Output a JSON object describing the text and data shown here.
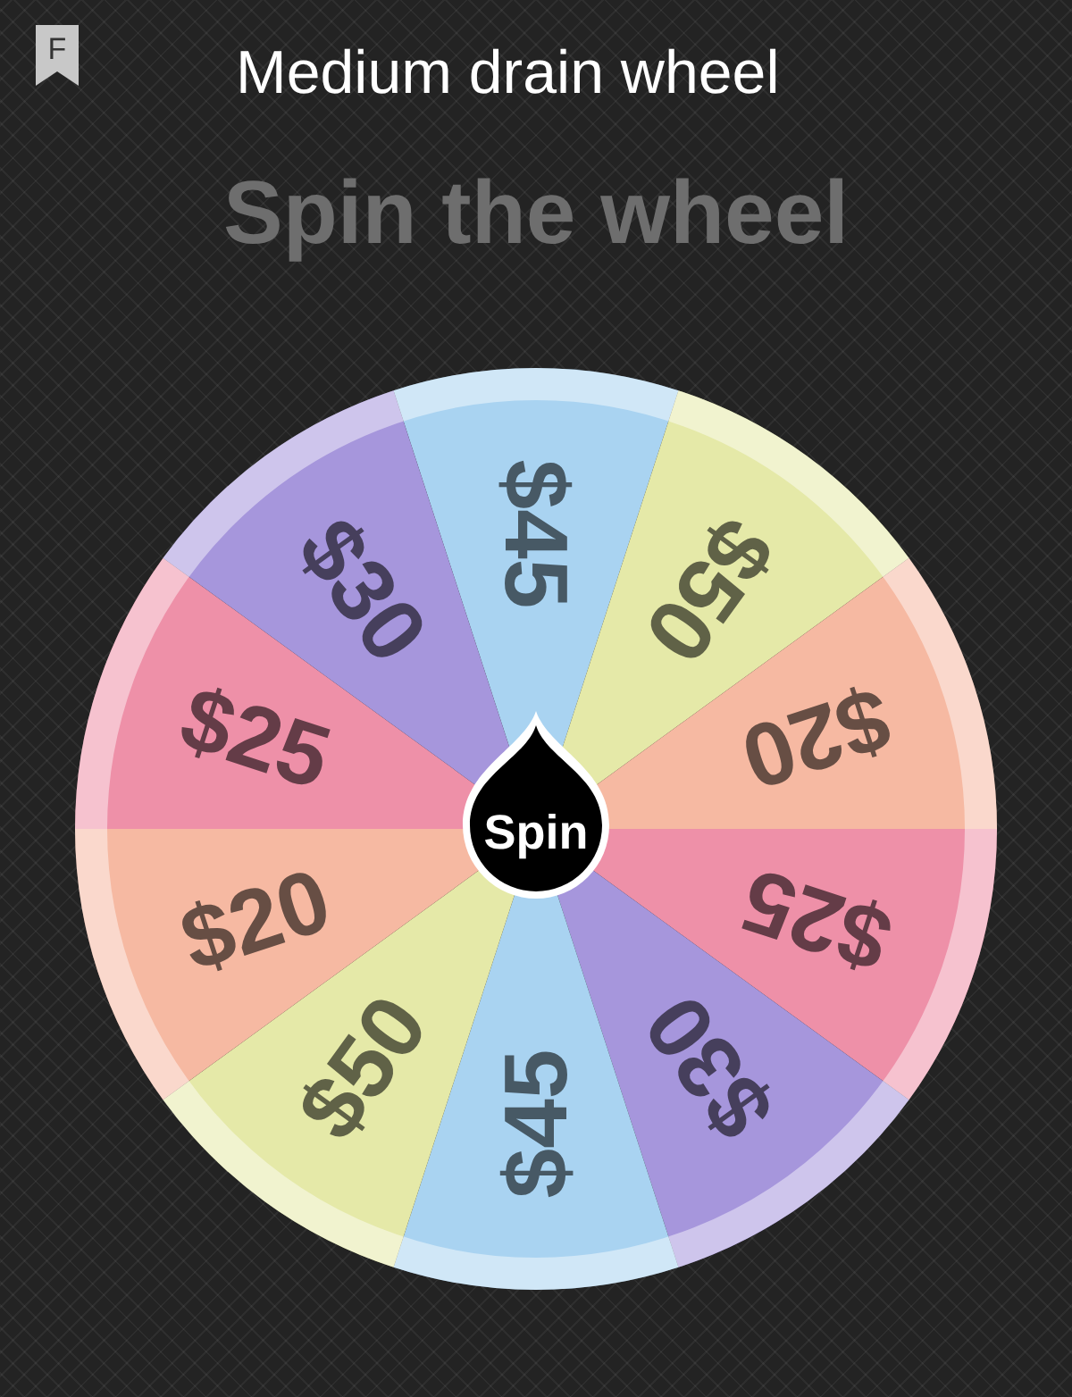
{
  "app_badge": {
    "letter": "F"
  },
  "title": "Medium drain wheel",
  "heading": "Spin the wheel",
  "wheel": {
    "segments": [
      {
        "label": "$45",
        "color": "#a9d3f1"
      },
      {
        "label": "$50",
        "color": "#e5e9a8"
      },
      {
        "label": "$20",
        "color": "#f6b9a2"
      },
      {
        "label": "$25",
        "color": "#ee90a8"
      },
      {
        "label": "$30",
        "color": "#a696dc"
      },
      {
        "label": "$45",
        "color": "#a9d3f1"
      },
      {
        "label": "$50",
        "color": "#e5e9a8"
      },
      {
        "label": "$20",
        "color": "#f6b9a2"
      },
      {
        "label": "$25",
        "color": "#ee90a8"
      },
      {
        "label": "$30",
        "color": "#a696dc"
      }
    ],
    "spin_button": "Spin"
  }
}
